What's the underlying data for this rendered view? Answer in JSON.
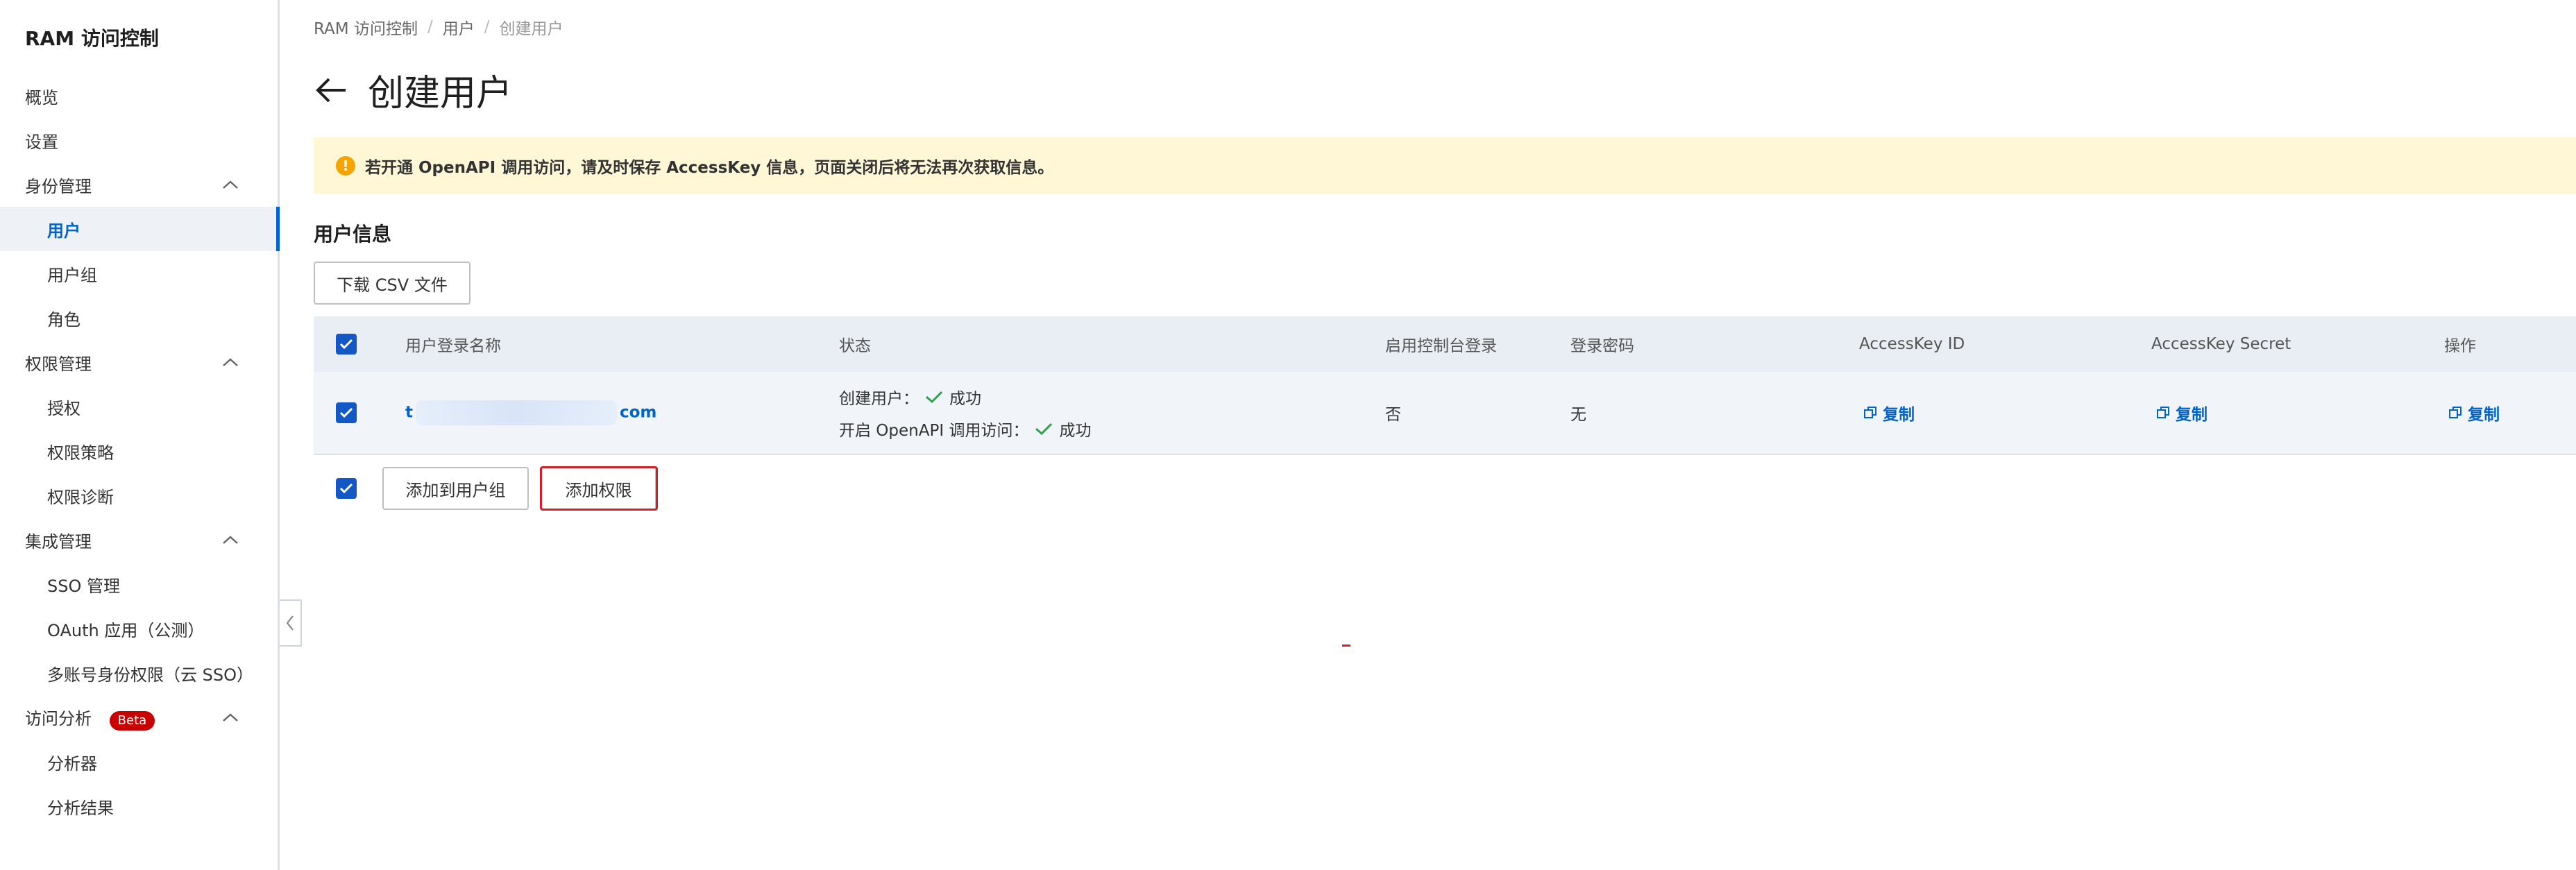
{
  "sidebar": {
    "title": "RAM 访问控制",
    "items": [
      {
        "label": "概览"
      },
      {
        "label": "设置"
      },
      {
        "label": "身份管理"
      },
      {
        "label": "用户"
      },
      {
        "label": "用户组"
      },
      {
        "label": "角色"
      },
      {
        "label": "权限管理"
      },
      {
        "label": "授权"
      },
      {
        "label": "权限策略"
      },
      {
        "label": "权限诊断"
      },
      {
        "label": "集成管理"
      },
      {
        "label": "SSO 管理"
      },
      {
        "label": "OAuth 应用（公测）"
      },
      {
        "label": "多账号身份权限（云 SSO）"
      },
      {
        "label": "访问分析",
        "badge": "Beta"
      },
      {
        "label": "分析器"
      },
      {
        "label": "分析结果"
      }
    ],
    "active_item": "用户",
    "badge_color": "#c80000"
  },
  "breadcrumb": {
    "items": [
      "RAM 访问控制",
      "用户",
      "创建用户"
    ]
  },
  "page": {
    "title": "创建用户",
    "back_icon": "arrow-left-icon"
  },
  "alert": {
    "icon": "warning-icon",
    "text": "若开通 OpenAPI 调用访问，请及时保存 AccessKey 信息，页面关闭后将无法再次获取信息。",
    "background": "#fff7d6"
  },
  "section": {
    "title": "用户信息",
    "download_button": "下载 CSV 文件"
  },
  "table": {
    "columns": [
      "用户登录名称",
      "状态",
      "启用控制台登录",
      "登录密码",
      "AccessKey ID",
      "AccessKey Secret",
      "操作"
    ],
    "rows": [
      {
        "checked": true,
        "username_prefix": "t",
        "username_suffix": "com",
        "status_lines": [
          {
            "label": "创建用户：",
            "value": "成功"
          },
          {
            "label": "开启 OpenAPI 调用访问：",
            "value": "成功"
          }
        ],
        "console_login": "否",
        "password": "无",
        "access_key_id": "复制",
        "access_key_secret": "复制",
        "action": "复制"
      }
    ]
  },
  "footer_actions": {
    "select_all_checked": true,
    "add_to_group": "添加到用户组",
    "add_permission": "添加权限"
  },
  "colors": {
    "accent": "#0064c8",
    "checkbox": "#1358c4",
    "success": "#2aa34a",
    "highlight": "#d0202a"
  }
}
